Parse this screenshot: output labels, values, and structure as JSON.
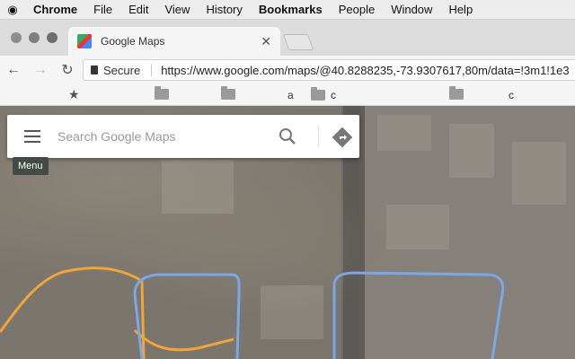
{
  "menubar": {
    "items": [
      "Chrome",
      "File",
      "Edit",
      "View",
      "History",
      "Bookmarks",
      "People",
      "Window",
      "Help"
    ]
  },
  "tab": {
    "title": "Google Maps"
  },
  "toolbar": {
    "secure_label": "Secure",
    "url": "https://www.google.com/maps/@40.8288235,-73.9307617,80m/data=!3m1!1e3"
  },
  "bookmarks": {
    "items": [
      "",
      "a",
      "c",
      "c"
    ]
  },
  "search": {
    "placeholder": "Search Google Maps",
    "menu_tooltip": "Menu"
  },
  "colors": {
    "route_blue": "#7aa7e8",
    "route_orange": "#f0a43a"
  }
}
